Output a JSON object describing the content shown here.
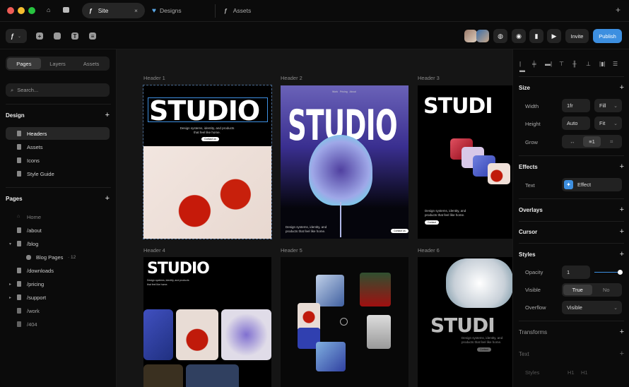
{
  "tabs": [
    {
      "label": "Site",
      "active": true
    },
    {
      "label": "Designs"
    },
    {
      "label": "Assets"
    }
  ],
  "toolbar": {
    "invite": "Invite",
    "publish": "Publish",
    "accent": "#3d8fe0"
  },
  "sidebar": {
    "segments": [
      "Pages",
      "Layers",
      "Assets"
    ],
    "search_placeholder": "Search...",
    "design_title": "Design",
    "design_items": [
      "Headers",
      "Assets",
      "Icons",
      "Style Guide"
    ],
    "pages_title": "Pages",
    "pages": [
      {
        "label": "Home"
      },
      {
        "label": "/about"
      },
      {
        "label": "/blog"
      },
      {
        "label": "Blog Pages",
        "count": "12"
      },
      {
        "label": "/downloads"
      },
      {
        "label": "/pricing"
      },
      {
        "label": "/support"
      },
      {
        "label": "/work"
      },
      {
        "label": "/404"
      }
    ]
  },
  "canvas": {
    "headers": [
      "Header 1",
      "Header 2",
      "Header 3",
      "Header 4",
      "Header 5",
      "Header 6"
    ],
    "studio": "STUDIO",
    "studio_clip": "STUDI",
    "tagline": "Design systems, identity, and products that feel like home.",
    "contact": "Contact us",
    "nav": [
      "Work",
      "Pricing",
      "About"
    ],
    "contact_short": "Contact"
  },
  "panel": {
    "size_title": "Size",
    "width_label": "Width",
    "width_value": "1fr",
    "width_mode": "Fill",
    "height_label": "Height",
    "height_value": "Auto",
    "height_mode": "Fit",
    "grow_label": "Grow",
    "effects_title": "Effects",
    "text_label": "Text",
    "effect_value": "Effect",
    "overlays_title": "Overlays",
    "cursor_title": "Cursor",
    "styles_title": "Styles",
    "opacity_label": "Opacity",
    "opacity_value": "1",
    "opacity_slider": 1.0,
    "visible_label": "Visible",
    "visible_true": "True",
    "visible_no": "No",
    "overflow_label": "Overflow",
    "overflow_value": "Visible",
    "transforms_title": "Transforms",
    "text_title": "Text",
    "text_styles_label": "Styles",
    "h1a": "H1",
    "h1b": "H1"
  }
}
